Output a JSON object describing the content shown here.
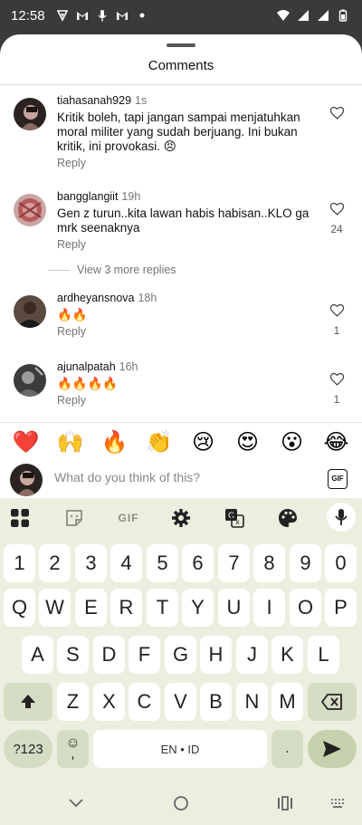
{
  "status_bar": {
    "time": "12:58",
    "left_icons": [
      "vpn-icon",
      "gmail-icon",
      "mic-icon",
      "gmail-icon",
      "dot-icon"
    ],
    "right_icons": [
      "wifi-icon",
      "signal-icon",
      "signal-icon",
      "battery-icon"
    ]
  },
  "sheet": {
    "title": "Comments"
  },
  "comments": [
    {
      "username": "tiahasanah929",
      "time": "1s",
      "text": "Kritik boleh, tapi jangan sampai menjatuhkan moral militer yang sudah berjuang. Ini bukan kritik, ini provokasi. 😠",
      "reply": "Reply",
      "likes": ""
    },
    {
      "username": "bangglangiit",
      "time": "19h",
      "text": "Gen z turun..kita lawan habis habisan..KLO ga mrk seenaknya",
      "reply": "Reply",
      "likes": "24"
    },
    {
      "username": "ardheyansnova",
      "time": "18h",
      "text": "🔥🔥",
      "reply": "Reply",
      "likes": "1"
    },
    {
      "username": "ajunalpatah",
      "time": "16h",
      "text": "🔥🔥🔥🔥",
      "reply": "Reply",
      "likes": "1"
    }
  ],
  "view_more": "View 3 more replies",
  "emoji_reactions": [
    "❤️",
    "🙌",
    "🔥",
    "👏",
    "😢",
    "😍",
    "😮",
    "😂"
  ],
  "composer": {
    "placeholder": "What do you think of this?",
    "gif_label": "GIF"
  },
  "keyboard": {
    "toolbar": {
      "gif_label": "GIF"
    },
    "rows": [
      [
        "1",
        "2",
        "3",
        "4",
        "5",
        "6",
        "7",
        "8",
        "9",
        "0"
      ],
      [
        "Q",
        "W",
        "E",
        "R",
        "T",
        "Y",
        "U",
        "I",
        "O",
        "P"
      ],
      [
        "A",
        "S",
        "D",
        "F",
        "G",
        "H",
        "J",
        "K",
        "L"
      ],
      [
        "Z",
        "X",
        "C",
        "V",
        "B",
        "N",
        "M"
      ]
    ],
    "symbols_label": "?123",
    "emoji_key": "☺",
    "comma_key": ",",
    "space_label": "EN • ID",
    "period_key": "."
  },
  "colors": {
    "keyboard_bg": "#ecefdf",
    "function_key": "#d5dcc4",
    "enter_key": "#c6d2ad"
  }
}
